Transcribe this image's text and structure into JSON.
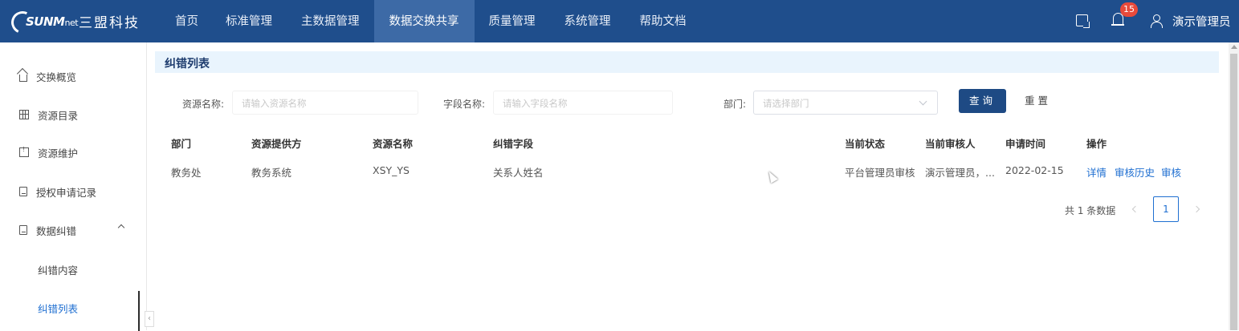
{
  "brand": {
    "word": "SUNM",
    "word_suffix": "net",
    "name_cn": "三盟科技"
  },
  "nav": {
    "items": [
      "首页",
      "标准管理",
      "主数据管理",
      "数据交换共享",
      "质量管理",
      "系统管理",
      "帮助文档"
    ],
    "active_index": 3
  },
  "header": {
    "notification_count": "15",
    "user_name": "演示管理员"
  },
  "sidebar": {
    "items": [
      "交换概览",
      "资源目录",
      "资源维护",
      "授权申请记录",
      "数据纠错"
    ],
    "sub_items": [
      "纠错内容",
      "纠错列表"
    ],
    "active_sub": "纠错列表"
  },
  "page": {
    "title": "纠错列表"
  },
  "filters": {
    "resource_label": "资源名称:",
    "resource_placeholder": "请输入资源名称",
    "field_label": "字段名称:",
    "field_placeholder": "请输入字段名称",
    "dept_label": "部门:",
    "dept_placeholder": "请选择部门",
    "query_label": "查询",
    "reset_label": "重置"
  },
  "table": {
    "columns": [
      "部门",
      "资源提供方",
      "资源名称",
      "纠错字段",
      "当前状态",
      "当前审核人",
      "申请时间",
      "操作"
    ],
    "rows": [
      {
        "dept": "教务处",
        "provider": "教务系统",
        "resource": "XSY_YS",
        "field": "关系人姓名",
        "status": "平台管理员审核",
        "reviewer": "演示管理员，...",
        "date": "2022-02-15",
        "actions": [
          "详情",
          "审核历史",
          "审核"
        ]
      }
    ]
  },
  "pagination": {
    "total_text": "共 1 条数据",
    "current_page": "1"
  },
  "colors": {
    "topbar": "#1f4e8c",
    "active_tab": "#3d6aa6",
    "link": "#1f6fd1",
    "badge": "#e84a3b",
    "primary_button": "#1e4a84"
  }
}
